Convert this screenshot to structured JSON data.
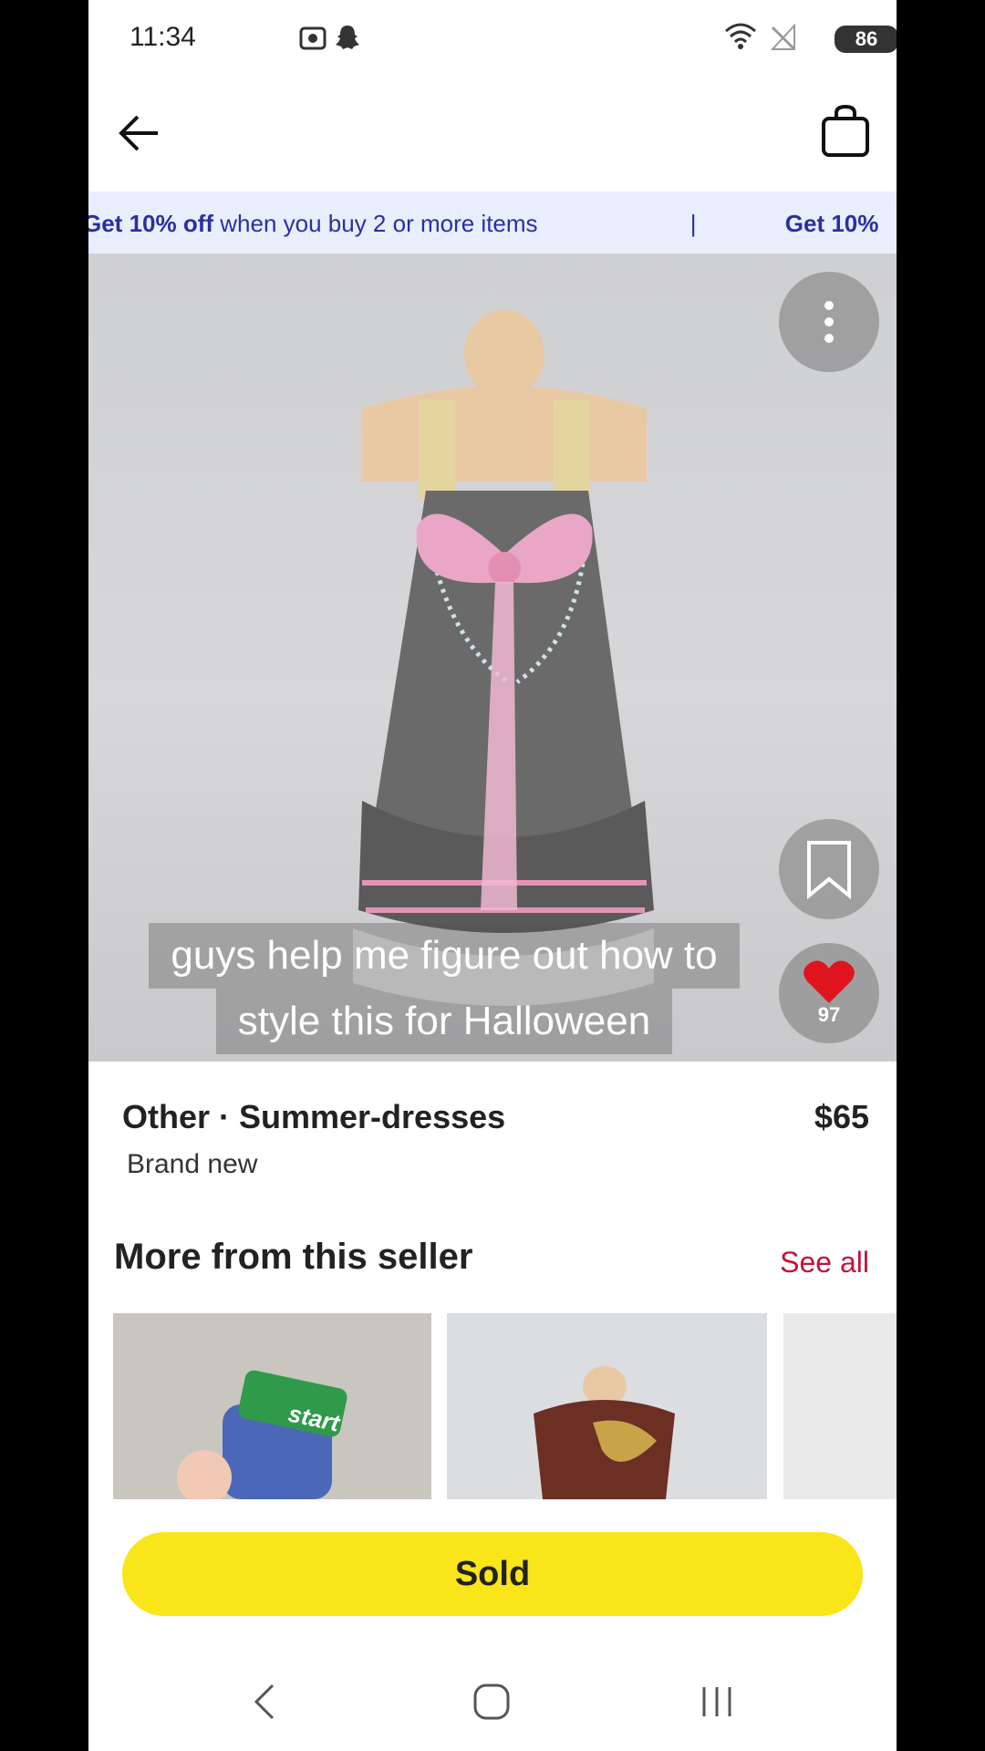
{
  "status_bar": {
    "time": "11:34",
    "battery": "86",
    "icons": [
      "screen-record-icon",
      "snapchat-icon",
      "wifi-icon",
      "no-signal-icon",
      "battery-icon"
    ]
  },
  "header": {
    "back_icon": "arrow-left-icon",
    "bag_icon": "shopping-bag-icon"
  },
  "promo": {
    "bold_text": "Get 10% off",
    "text": "when you buy 2 or more items",
    "separator": "|",
    "repeat_bold": "Get 10%"
  },
  "hero": {
    "caption_line1": "guys help me figure out how to",
    "caption_line2": "style this for Halloween",
    "likes_count": "97",
    "more_icon": "more-vertical-icon",
    "bookmark_icon": "bookmark-icon",
    "heart_icon": "heart-icon"
  },
  "listing": {
    "category": "Other · Summer-dresses",
    "price": "$65",
    "condition": "Brand new"
  },
  "more_from_seller": {
    "heading": "More from this seller",
    "see_all": "See all",
    "thumb1_text": "start"
  },
  "buy_button": {
    "label": "Sold"
  },
  "colors": {
    "accent_yellow": "#f9e51a",
    "link_red": "#c4123a",
    "promo_bg": "#e8eefc",
    "promo_text": "#2b2fa0",
    "heart_red": "#e0141e"
  }
}
